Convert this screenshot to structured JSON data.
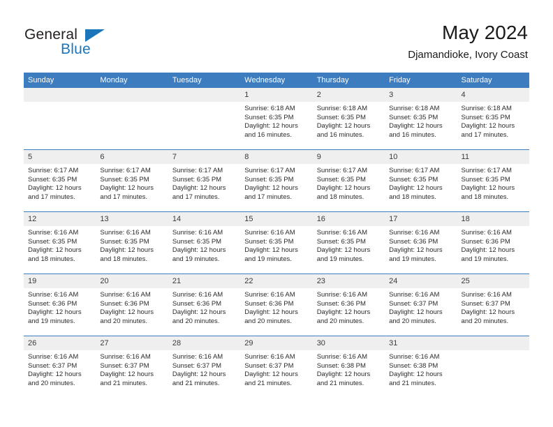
{
  "brand": {
    "name_part1": "General",
    "name_part2": "Blue",
    "accent_color": "#1b75bb"
  },
  "header": {
    "title": "May 2024",
    "subtitle": "Djamandioke, Ivory Coast"
  },
  "calendar": {
    "header_bg": "#3c7cbf",
    "daynum_bg": "#efefef",
    "weekday_headers": [
      "Sunday",
      "Monday",
      "Tuesday",
      "Wednesday",
      "Thursday",
      "Friday",
      "Saturday"
    ],
    "weeks": [
      [
        {
          "day": "",
          "lines": []
        },
        {
          "day": "",
          "lines": []
        },
        {
          "day": "",
          "lines": []
        },
        {
          "day": "1",
          "lines": [
            "Sunrise: 6:18 AM",
            "Sunset: 6:35 PM",
            "Daylight: 12 hours",
            "and 16 minutes."
          ]
        },
        {
          "day": "2",
          "lines": [
            "Sunrise: 6:18 AM",
            "Sunset: 6:35 PM",
            "Daylight: 12 hours",
            "and 16 minutes."
          ]
        },
        {
          "day": "3",
          "lines": [
            "Sunrise: 6:18 AM",
            "Sunset: 6:35 PM",
            "Daylight: 12 hours",
            "and 16 minutes."
          ]
        },
        {
          "day": "4",
          "lines": [
            "Sunrise: 6:18 AM",
            "Sunset: 6:35 PM",
            "Daylight: 12 hours",
            "and 17 minutes."
          ]
        }
      ],
      [
        {
          "day": "5",
          "lines": [
            "Sunrise: 6:17 AM",
            "Sunset: 6:35 PM",
            "Daylight: 12 hours",
            "and 17 minutes."
          ]
        },
        {
          "day": "6",
          "lines": [
            "Sunrise: 6:17 AM",
            "Sunset: 6:35 PM",
            "Daylight: 12 hours",
            "and 17 minutes."
          ]
        },
        {
          "day": "7",
          "lines": [
            "Sunrise: 6:17 AM",
            "Sunset: 6:35 PM",
            "Daylight: 12 hours",
            "and 17 minutes."
          ]
        },
        {
          "day": "8",
          "lines": [
            "Sunrise: 6:17 AM",
            "Sunset: 6:35 PM",
            "Daylight: 12 hours",
            "and 17 minutes."
          ]
        },
        {
          "day": "9",
          "lines": [
            "Sunrise: 6:17 AM",
            "Sunset: 6:35 PM",
            "Daylight: 12 hours",
            "and 18 minutes."
          ]
        },
        {
          "day": "10",
          "lines": [
            "Sunrise: 6:17 AM",
            "Sunset: 6:35 PM",
            "Daylight: 12 hours",
            "and 18 minutes."
          ]
        },
        {
          "day": "11",
          "lines": [
            "Sunrise: 6:17 AM",
            "Sunset: 6:35 PM",
            "Daylight: 12 hours",
            "and 18 minutes."
          ]
        }
      ],
      [
        {
          "day": "12",
          "lines": [
            "Sunrise: 6:16 AM",
            "Sunset: 6:35 PM",
            "Daylight: 12 hours",
            "and 18 minutes."
          ]
        },
        {
          "day": "13",
          "lines": [
            "Sunrise: 6:16 AM",
            "Sunset: 6:35 PM",
            "Daylight: 12 hours",
            "and 18 minutes."
          ]
        },
        {
          "day": "14",
          "lines": [
            "Sunrise: 6:16 AM",
            "Sunset: 6:35 PM",
            "Daylight: 12 hours",
            "and 19 minutes."
          ]
        },
        {
          "day": "15",
          "lines": [
            "Sunrise: 6:16 AM",
            "Sunset: 6:35 PM",
            "Daylight: 12 hours",
            "and 19 minutes."
          ]
        },
        {
          "day": "16",
          "lines": [
            "Sunrise: 6:16 AM",
            "Sunset: 6:35 PM",
            "Daylight: 12 hours",
            "and 19 minutes."
          ]
        },
        {
          "day": "17",
          "lines": [
            "Sunrise: 6:16 AM",
            "Sunset: 6:36 PM",
            "Daylight: 12 hours",
            "and 19 minutes."
          ]
        },
        {
          "day": "18",
          "lines": [
            "Sunrise: 6:16 AM",
            "Sunset: 6:36 PM",
            "Daylight: 12 hours",
            "and 19 minutes."
          ]
        }
      ],
      [
        {
          "day": "19",
          "lines": [
            "Sunrise: 6:16 AM",
            "Sunset: 6:36 PM",
            "Daylight: 12 hours",
            "and 19 minutes."
          ]
        },
        {
          "day": "20",
          "lines": [
            "Sunrise: 6:16 AM",
            "Sunset: 6:36 PM",
            "Daylight: 12 hours",
            "and 20 minutes."
          ]
        },
        {
          "day": "21",
          "lines": [
            "Sunrise: 6:16 AM",
            "Sunset: 6:36 PM",
            "Daylight: 12 hours",
            "and 20 minutes."
          ]
        },
        {
          "day": "22",
          "lines": [
            "Sunrise: 6:16 AM",
            "Sunset: 6:36 PM",
            "Daylight: 12 hours",
            "and 20 minutes."
          ]
        },
        {
          "day": "23",
          "lines": [
            "Sunrise: 6:16 AM",
            "Sunset: 6:36 PM",
            "Daylight: 12 hours",
            "and 20 minutes."
          ]
        },
        {
          "day": "24",
          "lines": [
            "Sunrise: 6:16 AM",
            "Sunset: 6:37 PM",
            "Daylight: 12 hours",
            "and 20 minutes."
          ]
        },
        {
          "day": "25",
          "lines": [
            "Sunrise: 6:16 AM",
            "Sunset: 6:37 PM",
            "Daylight: 12 hours",
            "and 20 minutes."
          ]
        }
      ],
      [
        {
          "day": "26",
          "lines": [
            "Sunrise: 6:16 AM",
            "Sunset: 6:37 PM",
            "Daylight: 12 hours",
            "and 20 minutes."
          ]
        },
        {
          "day": "27",
          "lines": [
            "Sunrise: 6:16 AM",
            "Sunset: 6:37 PM",
            "Daylight: 12 hours",
            "and 21 minutes."
          ]
        },
        {
          "day": "28",
          "lines": [
            "Sunrise: 6:16 AM",
            "Sunset: 6:37 PM",
            "Daylight: 12 hours",
            "and 21 minutes."
          ]
        },
        {
          "day": "29",
          "lines": [
            "Sunrise: 6:16 AM",
            "Sunset: 6:37 PM",
            "Daylight: 12 hours",
            "and 21 minutes."
          ]
        },
        {
          "day": "30",
          "lines": [
            "Sunrise: 6:16 AM",
            "Sunset: 6:38 PM",
            "Daylight: 12 hours",
            "and 21 minutes."
          ]
        },
        {
          "day": "31",
          "lines": [
            "Sunrise: 6:16 AM",
            "Sunset: 6:38 PM",
            "Daylight: 12 hours",
            "and 21 minutes."
          ]
        },
        {
          "day": "",
          "lines": []
        }
      ]
    ]
  }
}
